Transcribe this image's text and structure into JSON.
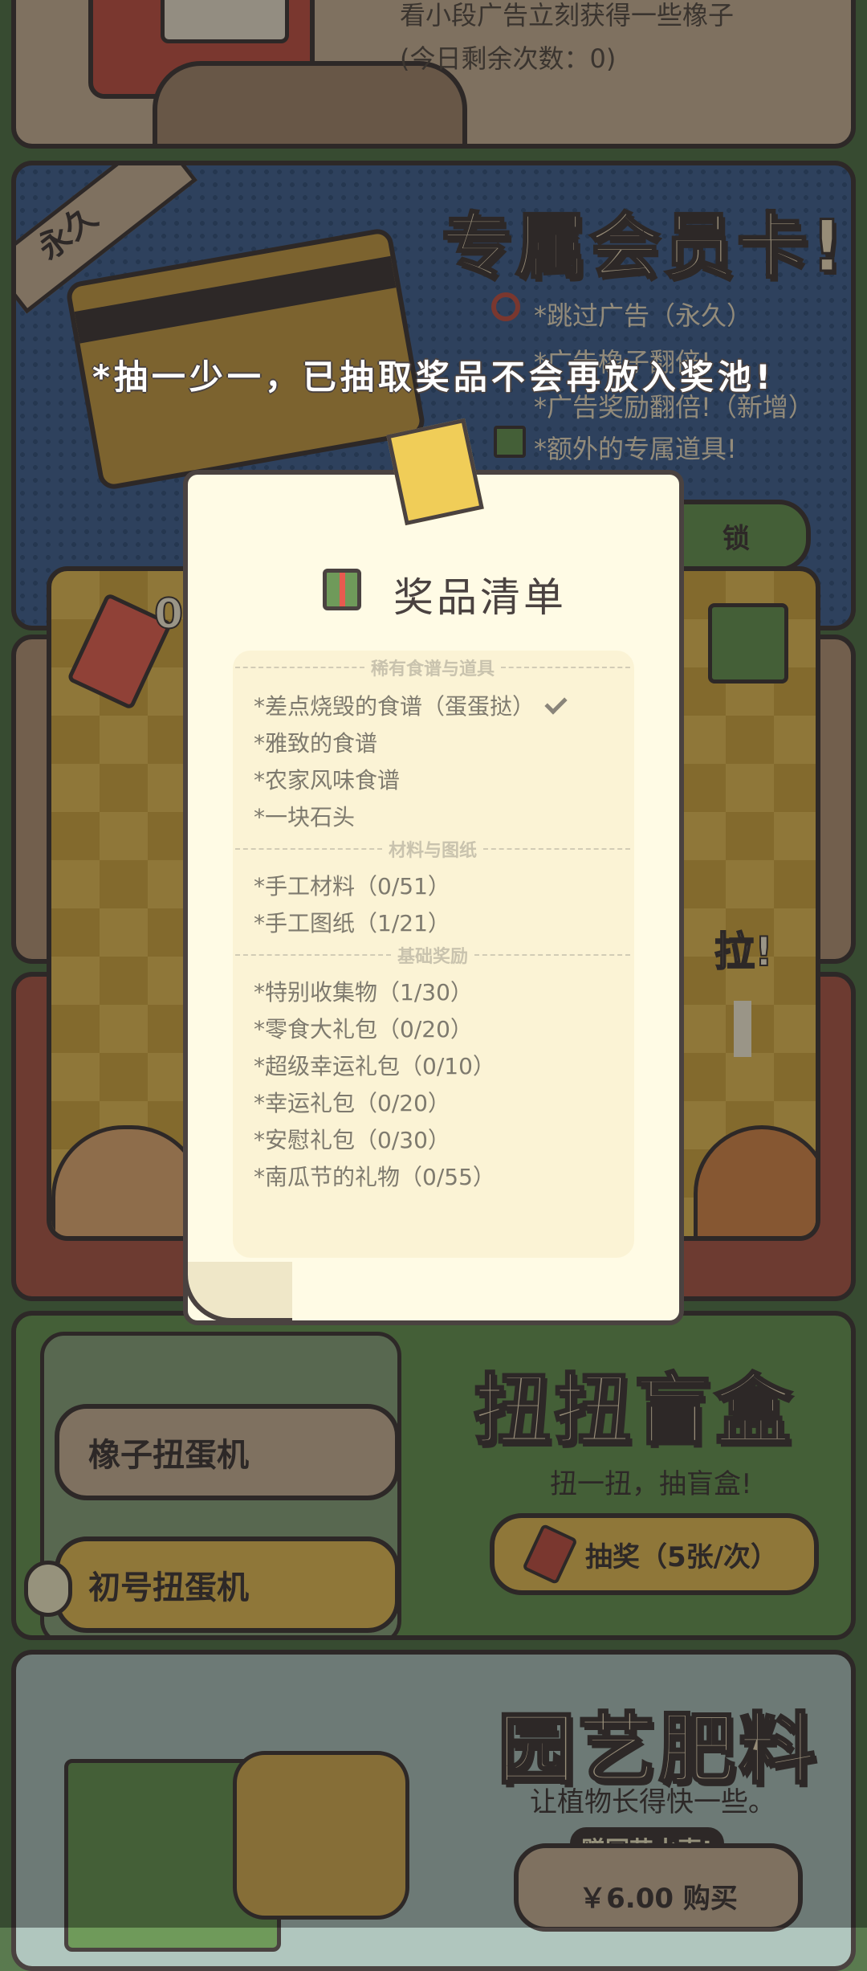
{
  "top_card": {
    "line1": "看小段广告立刻获得一些橡子",
    "line2": "(今日剩余次数：0)"
  },
  "member_card": {
    "ribbon": "永久",
    "title": "专属会员卡!",
    "benefits": [
      "*跳过广告（永久）",
      "*广告橡子翻倍!",
      "*广告奖励翻倍!（新增）",
      "*额外的专属道具!"
    ],
    "unlock_label": "锁"
  },
  "gacha_left_count": "0",
  "pull_label": "拉!",
  "overlay_notice": "*抽一少一，已抽取奖品不会再放入奖池!",
  "prize_list": {
    "title": "奖品清单",
    "sections": [
      {
        "header": "稀有食谱与道具",
        "items": [
          "*差点烧毁的食谱（蛋蛋挞）",
          "*雅致的食谱",
          "*农家风味食谱",
          "*一块石头"
        ]
      },
      {
        "header": "材料与图纸",
        "items": [
          "*手工材料（0/51）",
          "*手工图纸（1/21）"
        ]
      },
      {
        "header": "基础奖励",
        "items": [
          "*特别收集物（1/30）",
          "*零食大礼包（0/20）",
          "*超级幸运礼包（0/10）",
          "*幸运礼包（0/20）",
          "*安慰礼包（0/30）",
          "*南瓜节的礼物（0/55）"
        ]
      }
    ]
  },
  "gacha_card": {
    "machine1": "橡子扭蛋机",
    "machine2": "初号扭蛋机",
    "title": "扭扭盲盒",
    "subtitle": "扭一扭，抽盲盒!",
    "button": "抽奖（5张/次）"
  },
  "garden_card": {
    "title": "园艺肥料",
    "subtitle": "让植物长得快一些。",
    "tag": "赠园艺水壶!",
    "price": "￥6.00 购买"
  },
  "colors": {
    "outline": "#4a4240",
    "paper": "#fffbe5",
    "blue": "#4b6a96",
    "green": "#6f9a5a",
    "gold": "#e7c15c"
  }
}
